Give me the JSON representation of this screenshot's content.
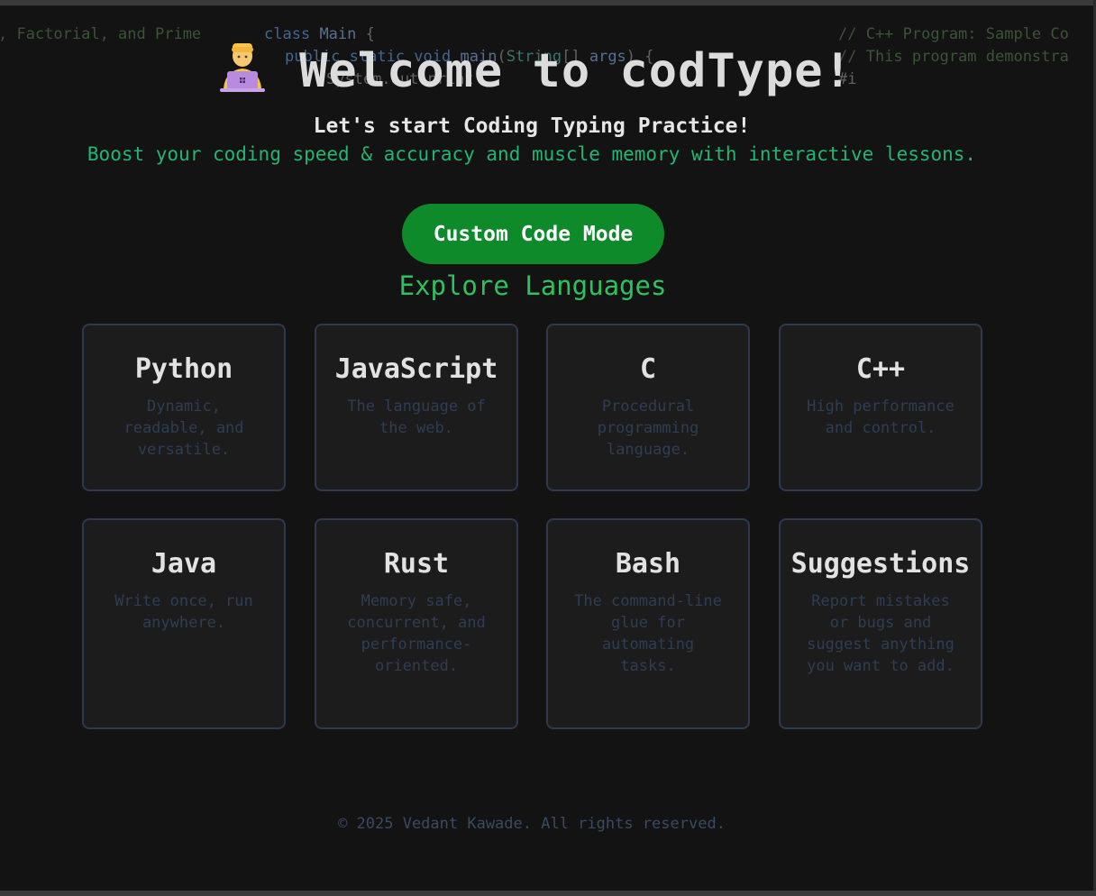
{
  "background_code": {
    "left_fragment": ", Factorial, and Prime",
    "java_line1_kw": "class",
    "java_line1_name": "Main",
    "java_line1_brace": "{",
    "java_line2_mods": "public static void",
    "java_line2_fn": "main",
    "java_line2_type": "String",
    "java_line2_rest": "[]",
    "java_line2_arg": "args",
    "java_line2_end": ") {",
    "java_line3": "System.out.print",
    "cpp_comment1": "// C++ Program: Sample Co",
    "cpp_comment2": "// This program demonstra",
    "cpp_line3": "#i"
  },
  "hero": {
    "emoji_icon": "technologist-emoji",
    "title": "Welcome to codType!",
    "subtitle": "Let's start Coding Typing Practice!",
    "tagline": "Boost your coding speed & accuracy and muscle memory with interactive lessons."
  },
  "actions": {
    "custom_mode_label": "Custom Code Mode"
  },
  "section": {
    "title": "Explore Languages"
  },
  "languages": [
    {
      "name": "Python",
      "description": "Dynamic, readable, and versatile."
    },
    {
      "name": "JavaScript",
      "description": "The language of the web."
    },
    {
      "name": "C",
      "description": "Procedural programming language."
    },
    {
      "name": "C++",
      "description": "High performance and control."
    },
    {
      "name": "Java",
      "description": "Write once, run anywhere."
    },
    {
      "name": "Rust",
      "description": "Memory safe, concurrent, and performance-oriented."
    },
    {
      "name": "Bash",
      "description": "The command-line glue for automating tasks."
    },
    {
      "name": "Suggestions",
      "description": "Report mistakes or bugs and suggest anything you want to add."
    }
  ],
  "footer": {
    "text": "© 2025 Vedant Kawade. All rights reserved."
  },
  "colors": {
    "background": "#131313",
    "accent_green": "#22b573",
    "button_green": "#0f8a2b",
    "card_border": "#2d3a4c"
  }
}
